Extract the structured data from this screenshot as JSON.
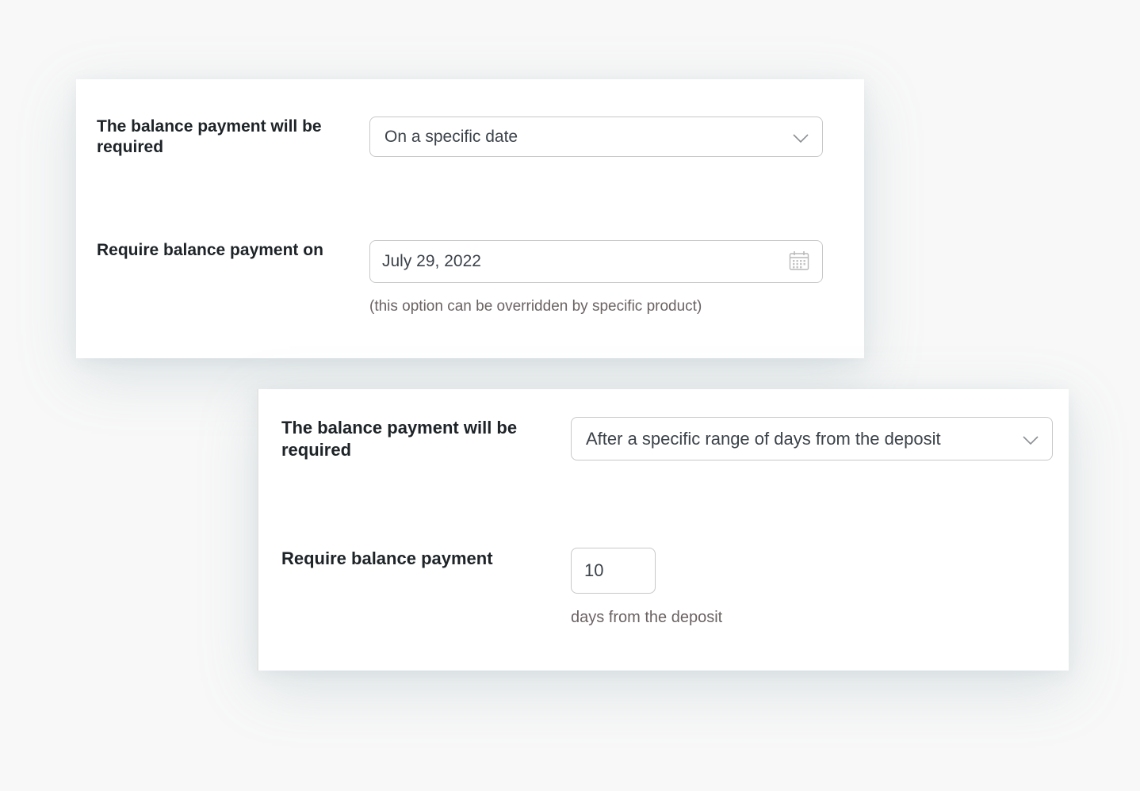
{
  "panel_specific_date": {
    "mode_label": "The balance payment will be required",
    "mode_value": "On a specific date",
    "date_label": "Require balance payment on",
    "date_value": "July 29, 2022",
    "date_hint": "(this option can be overridden by specific product)"
  },
  "panel_days_range": {
    "mode_label": "The balance payment will be required",
    "mode_value": "After a specific range of days from the deposit",
    "days_label": "Require balance payment",
    "days_value": "10",
    "days_hint": "days from the deposit"
  },
  "icons": {
    "select_arrow": "chevron-down-icon",
    "date_picker": "calendar-icon"
  },
  "colors": {
    "label_text": "#1d2327",
    "field_text": "#3c434a",
    "hint_text": "#6b6263",
    "field_border": "#c8c8c8",
    "panel_background": "#ffffff",
    "page_background": "#f8f8f8"
  }
}
